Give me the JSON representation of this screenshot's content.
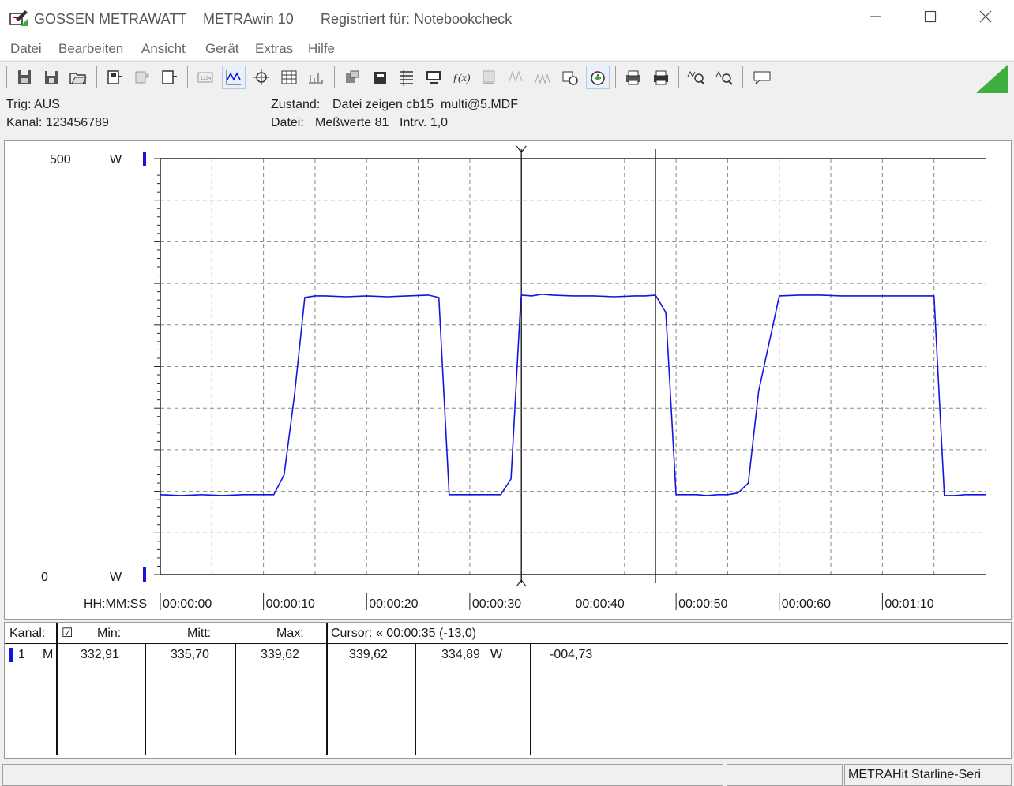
{
  "window": {
    "brand": "GOSSEN METRAWATT",
    "app_name": "METRAwin 10",
    "registered": "Registriert für: Notebookcheck"
  },
  "menu": [
    "Datei",
    "Bearbeiten",
    "Ansicht",
    "Gerät",
    "Extras",
    "Hilfe"
  ],
  "toolbar_icons": [
    "save-icon",
    "save-as-icon",
    "open-folder-icon",
    "device-read-icon",
    "device-config-icon",
    "device-send-icon",
    "display-icon",
    "graph-icon",
    "cursor-icon",
    "table-icon",
    "scale-icon",
    "export-icon",
    "import-icon",
    "list-icon",
    "computer-icon",
    "function-icon",
    "memory-icon",
    "wave-icon",
    "wave-filled-icon",
    "settings-icon",
    "clock-icon",
    "print-preview-icon",
    "print-icon",
    "zoom-in-icon",
    "zoom-out-icon",
    "info-icon"
  ],
  "info": {
    "trig": "Trig: AUS",
    "kanal": "Kanal: 123456789",
    "zustand_label": "Zustand:",
    "zustand_value": "Datei zeigen cb15_multi@5.MDF",
    "datei_label": "Datei:",
    "messwerte": "Meßwerte 81",
    "intrv": "Intrv. 1,0"
  },
  "chart_data": {
    "type": "line",
    "y_top_label": "500",
    "y_bottom_label": "0",
    "y_unit": "W",
    "ylim": [
      0,
      500
    ],
    "x_axis_label": "HH:MM:SS",
    "x_ticks": [
      "00:00:00",
      "00:00:10",
      "00:00:20",
      "00:00:30",
      "00:00:40",
      "00:00:50",
      "00:00:60",
      "00:01:10"
    ],
    "x_range_seconds": [
      0,
      80
    ],
    "grid": "dashed",
    "cursor_times": [
      35,
      48
    ],
    "series": [
      {
        "color": "#1414e0",
        "x": [
          0,
          2,
          4,
          6,
          8,
          10,
          11,
          12,
          13,
          14,
          15,
          16,
          18,
          20,
          22,
          24,
          26,
          27,
          28,
          29,
          30,
          31,
          32,
          33,
          34,
          34.9,
          35,
          36,
          37,
          38,
          40,
          42,
          44,
          46,
          47,
          48,
          49,
          50,
          51,
          52,
          53,
          54,
          55,
          56,
          57,
          58,
          60,
          62,
          64,
          66,
          68,
          70,
          71,
          72,
          73,
          74,
          75,
          76,
          77,
          78,
          79,
          80
        ],
        "y": [
          96,
          95,
          96,
          95,
          96,
          96,
          96,
          120,
          215,
          333,
          335,
          335,
          334,
          335,
          334,
          335,
          336,
          333,
          96,
          96,
          96,
          96,
          96,
          96,
          115,
          320,
          336,
          335,
          337,
          336,
          335,
          335,
          334,
          335,
          335,
          336,
          315,
          96,
          96,
          96,
          95,
          96,
          96,
          98,
          110,
          220,
          335,
          336,
          336,
          335,
          335,
          335,
          335,
          335,
          335,
          335,
          335,
          95,
          95,
          96,
          96,
          96
        ]
      }
    ]
  },
  "table": {
    "headers": {
      "kanal": "Kanal:",
      "check": "☑",
      "min": "Min:",
      "mitt": "Mitt:",
      "max": "Max:",
      "cursor": "Cursor: « 00:00:35 (-13,0)"
    },
    "row": {
      "channel": "1",
      "mode": "M",
      "min": "332,91",
      "mitt": "335,70",
      "max": "339,62",
      "cur1": "339,62",
      "cur2": "334,89",
      "unit": "W",
      "diff": "-004,73"
    }
  },
  "status": {
    "device": "METRAHit Starline-Seri"
  }
}
